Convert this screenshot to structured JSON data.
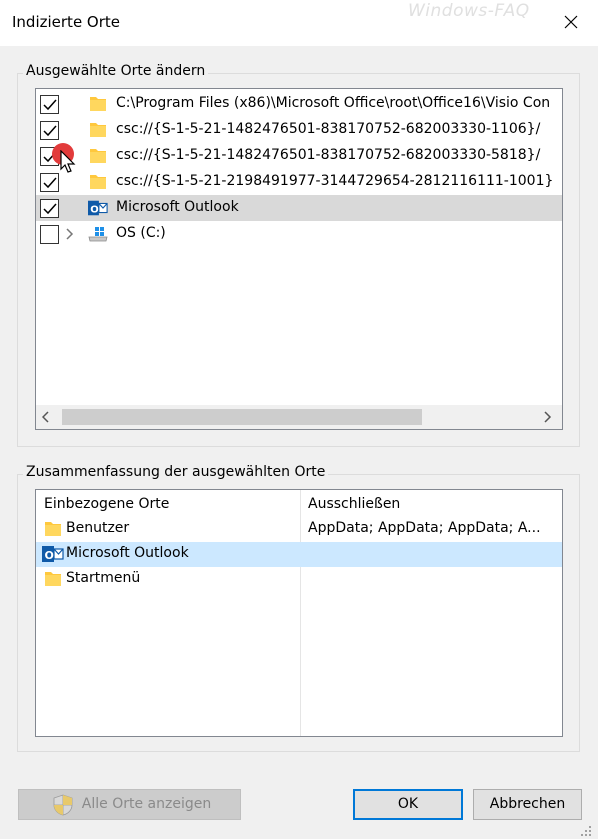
{
  "window": {
    "title": "Indizierte Orte",
    "watermark": "Windows-FAQ"
  },
  "locations_group": {
    "label": "Ausgewählte Orte ändern",
    "items": [
      {
        "checked": true,
        "icon": "folder-icon",
        "label": "C:\\Program Files (x86)\\Microsoft Office\\root\\Office16\\Visio Con"
      },
      {
        "checked": true,
        "icon": "folder-icon",
        "label": "csc://{S-1-5-21-1482476501-838170752-682003330-1106}/"
      },
      {
        "checked": true,
        "icon": "folder-icon",
        "label": "csc://{S-1-5-21-1482476501-838170752-682003330-5818}/"
      },
      {
        "checked": true,
        "icon": "folder-icon",
        "label": "csc://{S-1-5-21-2198491977-3144729654-2812116111-1001}"
      },
      {
        "checked": true,
        "icon": "outlook-icon",
        "label": "Microsoft Outlook",
        "selected": true
      },
      {
        "checked": false,
        "icon": "drive-icon",
        "label": "OS (C:)",
        "expandable": true
      }
    ]
  },
  "summary_group": {
    "label": "Zusammenfassung der ausgewählten Orte",
    "col_included": "Einbezogene Orte",
    "col_excluded": "Ausschließen",
    "rows": [
      {
        "icon": "folder-icon",
        "label": "Benutzer",
        "excluded": "AppData; AppData; AppData; A..."
      },
      {
        "icon": "outlook-icon",
        "label": "Microsoft Outlook",
        "excluded": "",
        "selected": true
      },
      {
        "icon": "folder-icon",
        "label": "Startmenü",
        "excluded": ""
      }
    ]
  },
  "buttons": {
    "show_all": "Alle Orte anzeigen",
    "ok": "OK",
    "cancel": "Abbrechen"
  },
  "colors": {
    "folder": "#ffc83d",
    "outlook": "#0f5aa8",
    "selection_gray": "#d9d9d9",
    "selection_blue": "#cce8ff",
    "accent": "#0078d7"
  }
}
